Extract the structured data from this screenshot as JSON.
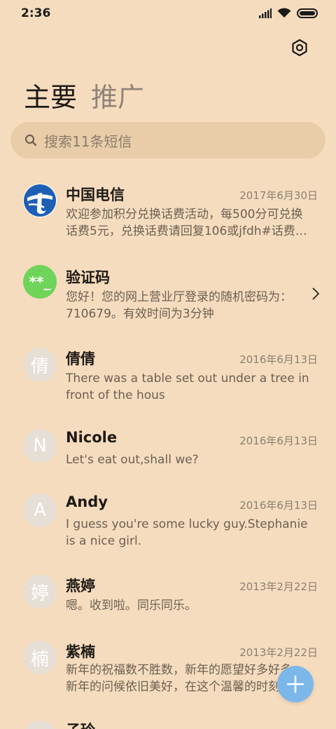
{
  "status_bar": {
    "time": "2:36"
  },
  "header": {
    "tabs": [
      {
        "label": "主要",
        "active": true
      },
      {
        "label": "推广",
        "active": false
      }
    ]
  },
  "search": {
    "placeholder": "搜索11条短信"
  },
  "conversations": [
    {
      "name": "中国电信",
      "date": "2017年6月30日",
      "preview": "欢迎参加积分兑换话费活动，每500分可兑换话费5元，兑换话费请回复106或jfdh#话费…",
      "avatar": "telecom-logo"
    },
    {
      "name": "验证码",
      "date": "",
      "preview": "您好！您的网上营业厅登录的随机密码为：710679。有效时间为3分钟",
      "avatar_text": "**_"
    },
    {
      "name": "倩倩",
      "date": "2016年6月13日",
      "preview": "There was a table set out under a tree in front of the hous",
      "avatar_text": "倩"
    },
    {
      "name": "Nicole",
      "date": "2016年6月13日",
      "preview": "Let's eat out,shall we?",
      "avatar_text": "N"
    },
    {
      "name": "Andy",
      "date": "2016年6月13日",
      "preview": "I guess you're some lucky guy.Stephanie is a nice girl.",
      "avatar_text": "A"
    },
    {
      "name": "燕婷",
      "date": "2013年2月22日",
      "preview": "嗯。收到啦。同乐同乐。",
      "avatar_text": "婷"
    },
    {
      "name": "紫楠",
      "date": "2013年2月22日",
      "preview": "新年的祝福数不胜数，新年的愿望好多好多，新年的问候依旧美好，在这个温馨的时刻",
      "avatar_text": "楠"
    },
    {
      "name": "子玲",
      "date": "",
      "preview": "",
      "avatar_text": ""
    }
  ],
  "colors": {
    "background": "#f6dcbe",
    "fab": "#7cb7ea",
    "search_bg": "#e9cda9"
  }
}
